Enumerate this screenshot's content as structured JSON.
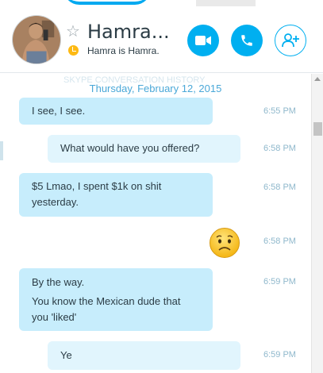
{
  "header": {
    "contact_name": "Hamra...",
    "mood_message": "Hamra is Hamra."
  },
  "chat": {
    "faded_header_text": "SKYPE CONVERSATION HISTORY",
    "date_divider": "Thursday, February 12, 2015",
    "messages": [
      {
        "kind": "text",
        "direction": "incoming",
        "lines": [
          "I see, I see."
        ],
        "time": "6:55 PM"
      },
      {
        "kind": "text",
        "direction": "outgoing",
        "lines": [
          "What would have you offered?"
        ],
        "time": "6:58 PM"
      },
      {
        "kind": "text",
        "direction": "incoming",
        "lines": [
          "$5 Lmao, I spent $1k on shit",
          "yesterday."
        ],
        "time": "6:58 PM"
      },
      {
        "kind": "emoticon",
        "direction": "outgoing",
        "emoticon": "worried-face-emoticon",
        "time": "6:58 PM"
      },
      {
        "kind": "text",
        "direction": "incoming",
        "lines": [
          "By the way.",
          "You know the Mexican dude that",
          "you 'liked'"
        ],
        "time": "6:59 PM"
      },
      {
        "kind": "text",
        "direction": "outgoing",
        "lines": [
          "Ye"
        ],
        "time": "6:59 PM"
      }
    ]
  },
  "icons": {
    "favorite": "star-outline-icon",
    "status": "away-clock-icon",
    "video_call": "video-camera-icon",
    "audio_call": "phone-icon",
    "add_people": "add-person-icon"
  },
  "colors": {
    "accent": "#00aff0",
    "incoming_bubble": "#c7edfc",
    "outgoing_bubble": "#e1f5fd",
    "date_text": "#4aa8d8",
    "timestamp": "#8fb8cc",
    "status_away": "#fdb913"
  }
}
